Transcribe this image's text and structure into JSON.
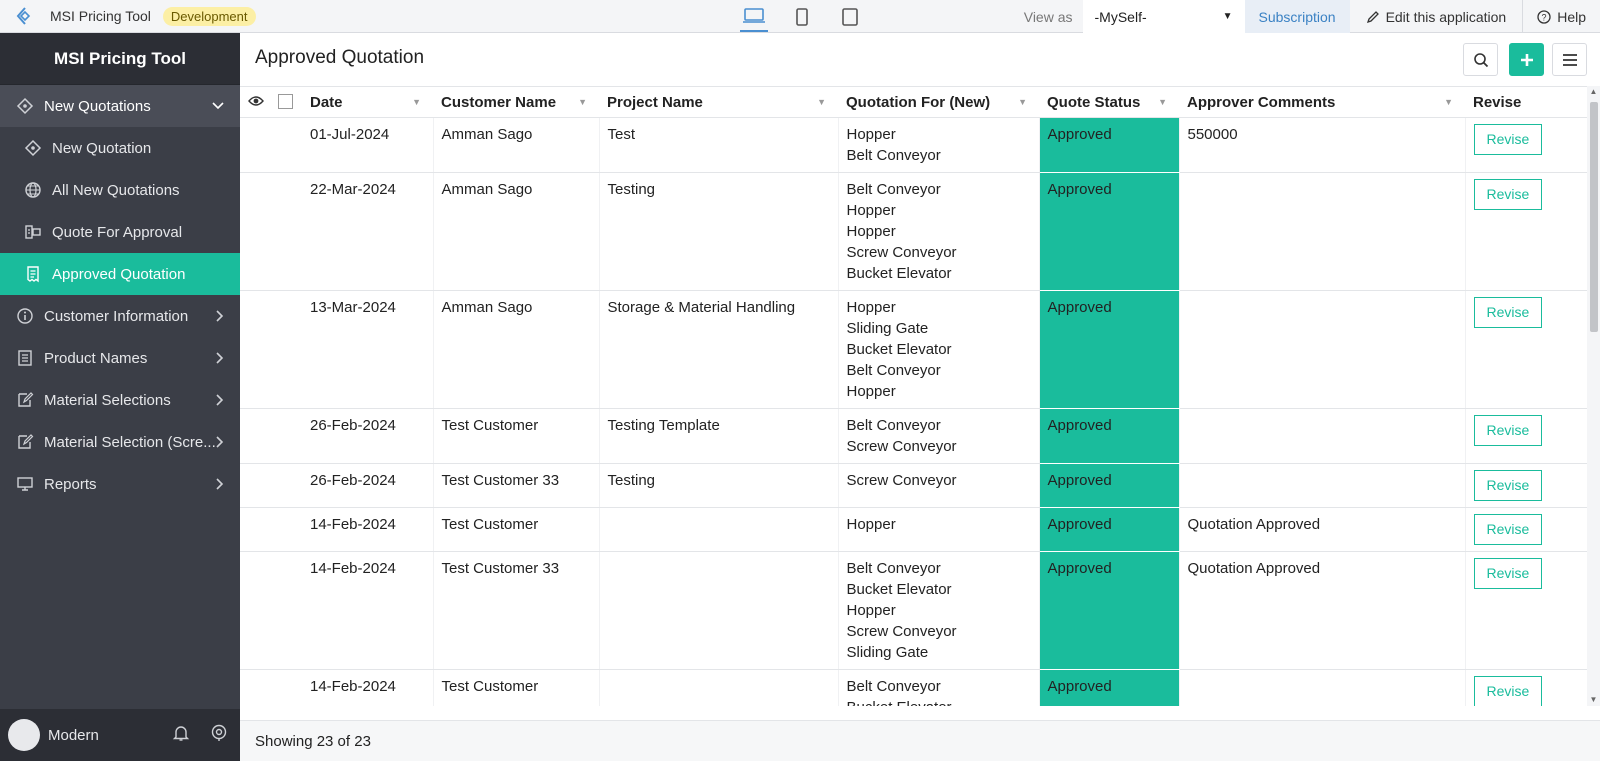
{
  "topbar": {
    "app_name": "MSI Pricing Tool",
    "env_badge": "Development",
    "view_as_label": "View as",
    "view_as_value": "-MySelf-",
    "subscription": "Subscription",
    "edit_app": "Edit this application",
    "help": "Help"
  },
  "sidebar": {
    "title": "MSI Pricing Tool",
    "group": {
      "label": "New Quotations",
      "icon": "quotation-icon"
    },
    "sub_items": [
      {
        "label": "New Quotation",
        "icon": "quotation-icon"
      },
      {
        "label": "All New Quotations",
        "icon": "globe-icon"
      },
      {
        "label": "Quote For Approval",
        "icon": "approval-icon"
      },
      {
        "label": "Approved Quotation",
        "icon": "receipt-icon",
        "active": true
      }
    ],
    "items": [
      {
        "label": "Customer Information",
        "icon": "info-icon"
      },
      {
        "label": "Product Names",
        "icon": "list-icon"
      },
      {
        "label": "Material Selections",
        "icon": "edit-icon"
      },
      {
        "label": "Material Selection (Scre...",
        "icon": "edit-icon"
      },
      {
        "label": "Reports",
        "icon": "monitor-icon"
      }
    ],
    "user": "Modern"
  },
  "main": {
    "title": "Approved Quotation",
    "columns": [
      "Date",
      "Customer Name",
      "Project Name",
      "Quotation For (New)",
      "Quote Status",
      "Approver Comments",
      "Revise"
    ],
    "rows": [
      {
        "date": "01-Jul-2024",
        "customer": "Amman Sago",
        "project": "Test",
        "items": "Hopper\nBelt Conveyor",
        "status": "Approved",
        "comments": "550000",
        "revise": "Revise"
      },
      {
        "date": "22-Mar-2024",
        "customer": "Amman Sago",
        "project": "Testing",
        "items": "Belt Conveyor\nHopper\nHopper\nScrew Conveyor\nBucket Elevator",
        "status": "Approved",
        "comments": "",
        "revise": "Revise"
      },
      {
        "date": "13-Mar-2024",
        "customer": "Amman Sago",
        "project": "Storage & Material Handling",
        "items": "Hopper\nSliding Gate\nBucket Elevator\nBelt Conveyor\nHopper",
        "status": "Approved",
        "comments": "",
        "revise": "Revise"
      },
      {
        "date": "26-Feb-2024",
        "customer": "Test Customer",
        "project": "Testing Template",
        "items": "Belt Conveyor\nScrew Conveyor",
        "status": "Approved",
        "comments": "",
        "revise": "Revise"
      },
      {
        "date": "26-Feb-2024",
        "customer": "Test Customer 33",
        "project": "Testing",
        "items": "Screw Conveyor",
        "status": "Approved",
        "comments": "",
        "revise": "Revise"
      },
      {
        "date": "14-Feb-2024",
        "customer": "Test Customer",
        "project": "",
        "items": "Hopper",
        "status": "Approved",
        "comments": "Quotation Approved",
        "revise": "Revise"
      },
      {
        "date": "14-Feb-2024",
        "customer": "Test Customer 33",
        "project": "",
        "items": "Belt Conveyor\nBucket Elevator\nHopper\nScrew Conveyor\nSliding Gate",
        "status": "Approved",
        "comments": "Quotation Approved",
        "revise": "Revise"
      },
      {
        "date": "14-Feb-2024",
        "customer": "Test Customer",
        "project": "",
        "items": "Belt Conveyor\nBucket Elevator\nScrew Conveyor",
        "status": "Approved",
        "comments": "",
        "revise": "Revise"
      }
    ],
    "footer": "Showing 23 of 23"
  },
  "colors": {
    "accent": "#1abc9c",
    "sidebar_bg": "#3b3e47",
    "link": "#3b82c4"
  }
}
